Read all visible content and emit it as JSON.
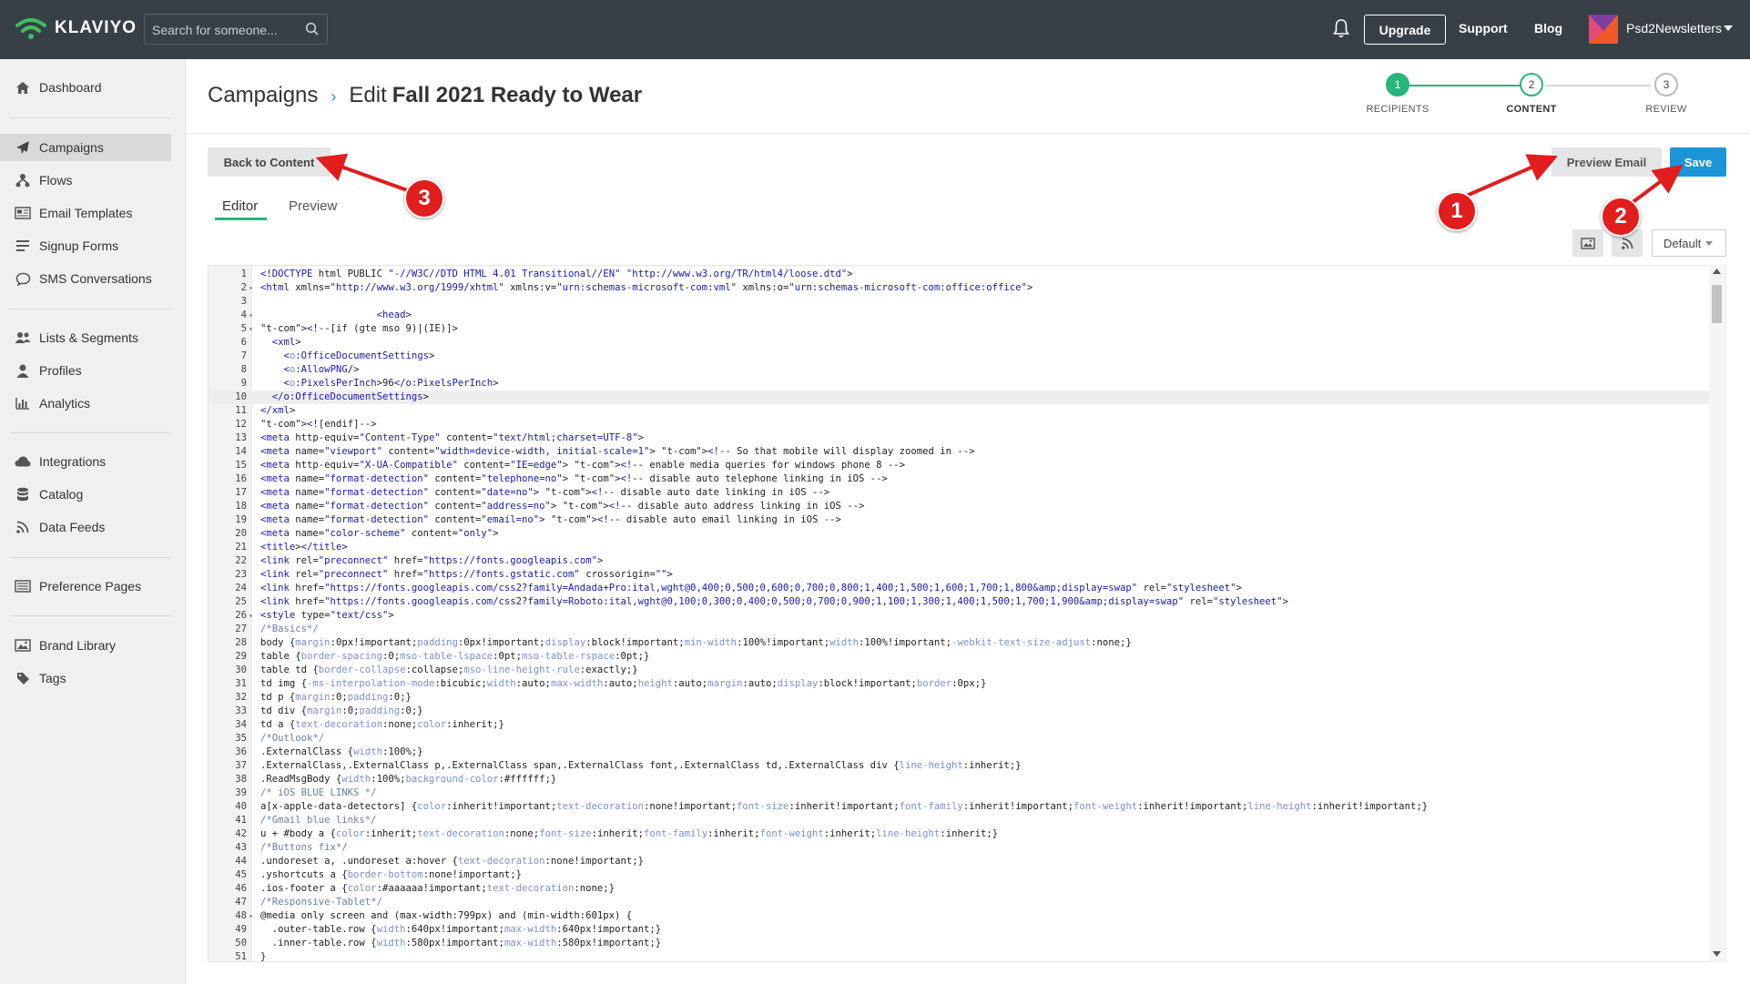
{
  "topbar": {
    "brand": "KLAVIYO",
    "search_placeholder": "Search for someone...",
    "upgrade_label": "Upgrade",
    "support_label": "Support",
    "blog_label": "Blog",
    "account_name": "Psd2Newsletters"
  },
  "sidebar": {
    "items": [
      {
        "label": "Dashboard",
        "icon": "home-icon"
      },
      {
        "label": "Campaigns",
        "icon": "paper-plane-icon",
        "active": true
      },
      {
        "label": "Flows",
        "icon": "flow-icon"
      },
      {
        "label": "Email Templates",
        "icon": "template-icon"
      },
      {
        "label": "Signup Forms",
        "icon": "form-icon"
      },
      {
        "label": "SMS Conversations",
        "icon": "chat-icon"
      },
      {
        "label": "Lists & Segments",
        "icon": "users-icon"
      },
      {
        "label": "Profiles",
        "icon": "user-icon"
      },
      {
        "label": "Analytics",
        "icon": "bar-chart-icon"
      },
      {
        "label": "Integrations",
        "icon": "cloud-icon"
      },
      {
        "label": "Catalog",
        "icon": "database-icon"
      },
      {
        "label": "Data Feeds",
        "icon": "rss-icon"
      },
      {
        "label": "Preference Pages",
        "icon": "page-icon"
      },
      {
        "label": "Brand Library",
        "icon": "image-icon"
      },
      {
        "label": "Tags",
        "icon": "tag-icon"
      }
    ]
  },
  "header": {
    "breadcrumb_root": "Campaigns",
    "breadcrumb_separator": "›",
    "edit_prefix": "Edit",
    "campaign_name": "Fall 2021 Ready to Wear"
  },
  "stepper": {
    "steps": [
      {
        "number": "1",
        "label": "RECIPIENTS",
        "state": "done"
      },
      {
        "number": "2",
        "label": "CONTENT",
        "state": "current"
      },
      {
        "number": "3",
        "label": "REVIEW",
        "state": "todo"
      }
    ],
    "accent_color": "#28b67a"
  },
  "toolbar": {
    "back_label": "Back to Content",
    "preview_label": "Preview Email",
    "save_label": "Save",
    "tabs": [
      "Editor",
      "Preview"
    ],
    "select_value": "Default",
    "save_color": "#1b95d8"
  },
  "annotations": [
    {
      "number": "1",
      "target": "Preview Email"
    },
    {
      "number": "2",
      "target": "Save"
    },
    {
      "number": "3",
      "target": "Back to Content"
    }
  ],
  "editor": {
    "active_line": 10,
    "lines": [
      "<!DOCTYPE html PUBLIC \"-//W3C//DTD HTML 4.01 Transitional//EN\" \"http://www.w3.org/TR/html4/loose.dtd\">",
      "<html xmlns=\"http://www.w3.org/1999/xhtml\" xmlns:v=\"urn:schemas-microsoft-com:vml\" xmlns:o=\"urn:schemas-microsoft-com:office:office\">",
      "",
      "                    <head>",
      "<!--[if (gte mso 9)|(IE)]>",
      "  <xml>",
      "    <o:OfficeDocumentSettings>",
      "    <o:AllowPNG/>",
      "    <o:PixelsPerInch>96</o:PixelsPerInch>",
      "  </o:OfficeDocumentSettings>",
      "</xml>",
      "<![endif]-->",
      "<meta http-equiv=\"Content-Type\" content=\"text/html;charset=UTF-8\">",
      "<meta name=\"viewport\" content=\"width=device-width, initial-scale=1\"> <!-- So that mobile will display zoomed in -->",
      "<meta http-equiv=\"X-UA-Compatible\" content=\"IE=edge\"> <!-- enable media queries for windows phone 8 -->",
      "<meta name=\"format-detection\" content=\"telephone=no\"> <!-- disable auto telephone linking in iOS -->",
      "<meta name=\"format-detection\" content=\"date=no\"> <!-- disable auto date linking in iOS -->",
      "<meta name=\"format-detection\" content=\"address=no\"> <!-- disable auto address linking in iOS -->",
      "<meta name=\"format-detection\" content=\"email=no\"> <!-- disable auto email linking in iOS -->",
      "<meta name=\"color-scheme\" content=\"only\">",
      "<title></title>",
      "<link rel=\"preconnect\" href=\"https://fonts.googleapis.com\">",
      "<link rel=\"preconnect\" href=\"https://fonts.gstatic.com\" crossorigin=\"\">",
      "<link href=\"https://fonts.googleapis.com/css2?family=Andada+Pro:ital,wght@0,400;0,500;0,600;0,700;0,800;1,400;1,500;1,600;1,700;1,800&amp;display=swap\" rel=\"stylesheet\">",
      "<link href=\"https://fonts.googleapis.com/css2?family=Roboto:ital,wght@0,100;0,300;0,400;0,500;0,700;0,900;1,100;1,300;1,400;1,500;1,700;1,900&amp;display=swap\" rel=\"stylesheet\">",
      "<style type=\"text/css\">",
      "/*Basics*/",
      "body {margin:0px!important;padding:0px!important;display:block!important;min-width:100%!important;width:100%!important;-webkit-text-size-adjust:none;}",
      "table {border-spacing:0;mso-table-lspace:0pt;mso-table-rspace:0pt;}",
      "table td {border-collapse:collapse;mso-line-height-rule:exactly;}",
      "td img {-ms-interpolation-mode:bicubic;width:auto;max-width:auto;height:auto;margin:auto;display:block!important;border:0px;}",
      "td p {margin:0;padding:0;}",
      "td div {margin:0;padding:0;}",
      "td a {text-decoration:none;color:inherit;}",
      "/*Outlook*/",
      ".ExternalClass {width:100%;}",
      ".ExternalClass,.ExternalClass p,.ExternalClass span,.ExternalClass font,.ExternalClass td,.ExternalClass div {line-height:inherit;}",
      ".ReadMsgBody {width:100%;background-color:#ffffff;}",
      "/* iOS BLUE LINKS */",
      "a[x-apple-data-detectors] {color:inherit!important;text-decoration:none!important;font-size:inherit!important;font-family:inherit!important;font-weight:inherit!important;line-height:inherit!important;}",
      "/*Gmail blue links*/",
      "u + #body a {color:inherit;text-decoration:none;font-size:inherit;font-family:inherit;font-weight:inherit;line-height:inherit;}",
      "/*Buttons fix*/",
      ".undoreset a, .undoreset a:hover {text-decoration:none!important;}",
      ".yshortcuts a {border-bottom:none!important;}",
      ".ios-footer a {color:#aaaaaa!important;text-decoration:none;}",
      "/*Responsive-Tablet*/",
      "@media only screen and (max-width:799px) and (min-width:601px) {",
      "  .outer-table.row {width:640px!important;max-width:640px!important;}",
      "  .inner-table.row {width:580px!important;max-width:580px!important;}",
      "}"
    ],
    "fold_lines": [
      2,
      4,
      5,
      26,
      48
    ]
  }
}
